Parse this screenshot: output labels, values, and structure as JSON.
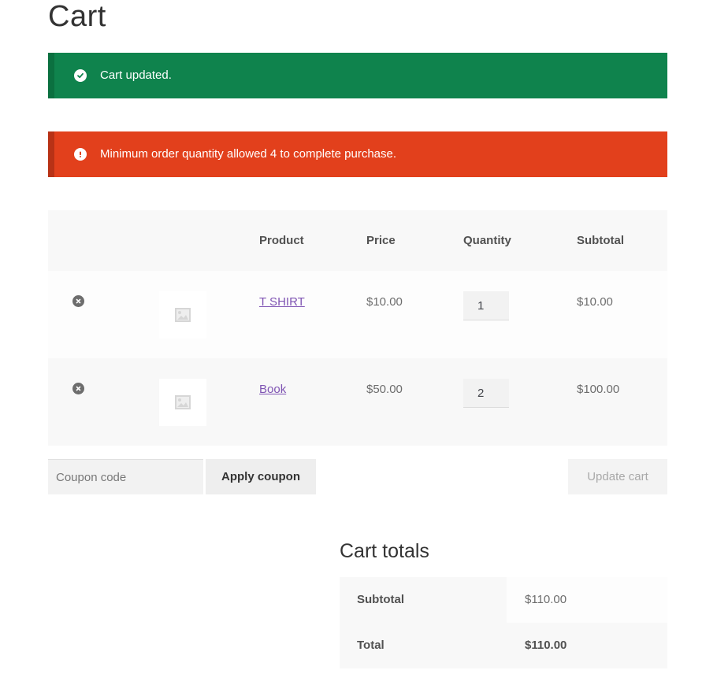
{
  "page": {
    "title": "Cart"
  },
  "notices": {
    "success": {
      "text": "Cart updated.",
      "icon": "check-circle-icon",
      "color": "#0f834d"
    },
    "error": {
      "text": "Minimum order quantity allowed 4 to complete purchase.",
      "icon": "exclamation-circle-icon",
      "color": "#e2401c"
    }
  },
  "cart": {
    "headers": {
      "product": "Product",
      "price": "Price",
      "quantity": "Quantity",
      "subtotal": "Subtotal"
    },
    "items": [
      {
        "name": "T SHIRT",
        "price": "$10.00",
        "quantity": "1",
        "subtotal": "$10.00"
      },
      {
        "name": "Book",
        "price": "$50.00",
        "quantity": "2",
        "subtotal": "$100.00"
      }
    ],
    "link_color": "#7f54b3"
  },
  "actions": {
    "coupon_placeholder": "Coupon code",
    "apply_coupon": "Apply coupon",
    "update_cart": "Update cart"
  },
  "totals": {
    "title": "Cart totals",
    "subtotal_label": "Subtotal",
    "subtotal_value": "$110.00",
    "total_label": "Total",
    "total_value": "$110.00"
  }
}
